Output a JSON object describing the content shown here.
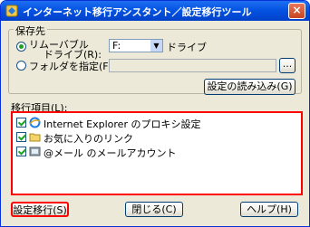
{
  "window": {
    "title": "インターネット移行アシスタント／設定移行ツール",
    "close_glyph": "×"
  },
  "destination": {
    "legend": "保存先",
    "removable_label_line1": "リムーバブル",
    "removable_label_line2": "ドライブ(R):",
    "drive_value": "F:",
    "drive_suffix": "ドライブ",
    "folder_label": "フォルダを指定(F):",
    "folder_value": "",
    "browse_label": "...",
    "load_settings_label": "設定の読み込み(G)",
    "selected_option": "removable"
  },
  "items_section": {
    "label": "移行項目(L):",
    "items": [
      {
        "text": "Internet Explorer のプロキシ設定",
        "checked": true,
        "icon": "ie-icon"
      },
      {
        "text": "お気に入りのリンク",
        "checked": true,
        "icon": "folder-icon"
      },
      {
        "text": "@メール のメールアカウント",
        "checked": true,
        "icon": "mail-icon"
      }
    ]
  },
  "footer": {
    "migrate_label": "設定移行(S)",
    "close_label": "閉じる(C)",
    "help_label": "ヘルプ(H)"
  }
}
